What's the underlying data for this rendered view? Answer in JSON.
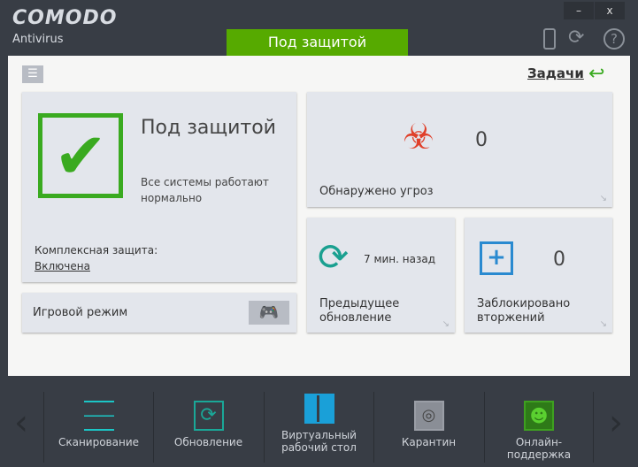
{
  "app": {
    "brand": "COMODO",
    "product": "Antivirus",
    "minimize": "–",
    "close": "x",
    "status": "Под защитой"
  },
  "header": {
    "tasks_label": "Задачи"
  },
  "protection": {
    "title": "Под защитой",
    "desc": "Все системы работают нормально",
    "complex_label": "Комплексная защита:",
    "complex_value": "Включена"
  },
  "game": {
    "label": "Игровой режим"
  },
  "threats": {
    "count": "0",
    "label": "Обнаружено угроз"
  },
  "update": {
    "time": "7 мин. назад",
    "label": "Предыдущее обновление"
  },
  "intrusions": {
    "count": "0",
    "label": "Заблокировано вторжений"
  },
  "toolbar": [
    {
      "label": "Сканирование",
      "color": "#1bc6c6"
    },
    {
      "label": "Обновление",
      "color": "#1aa898"
    },
    {
      "label": "Виртуальный рабочий стол",
      "color": "#1aa0d8"
    },
    {
      "label": "Карантин",
      "color": "#9a9ea6"
    },
    {
      "label": "Онлайн-поддержка",
      "color": "#3ea020"
    }
  ]
}
